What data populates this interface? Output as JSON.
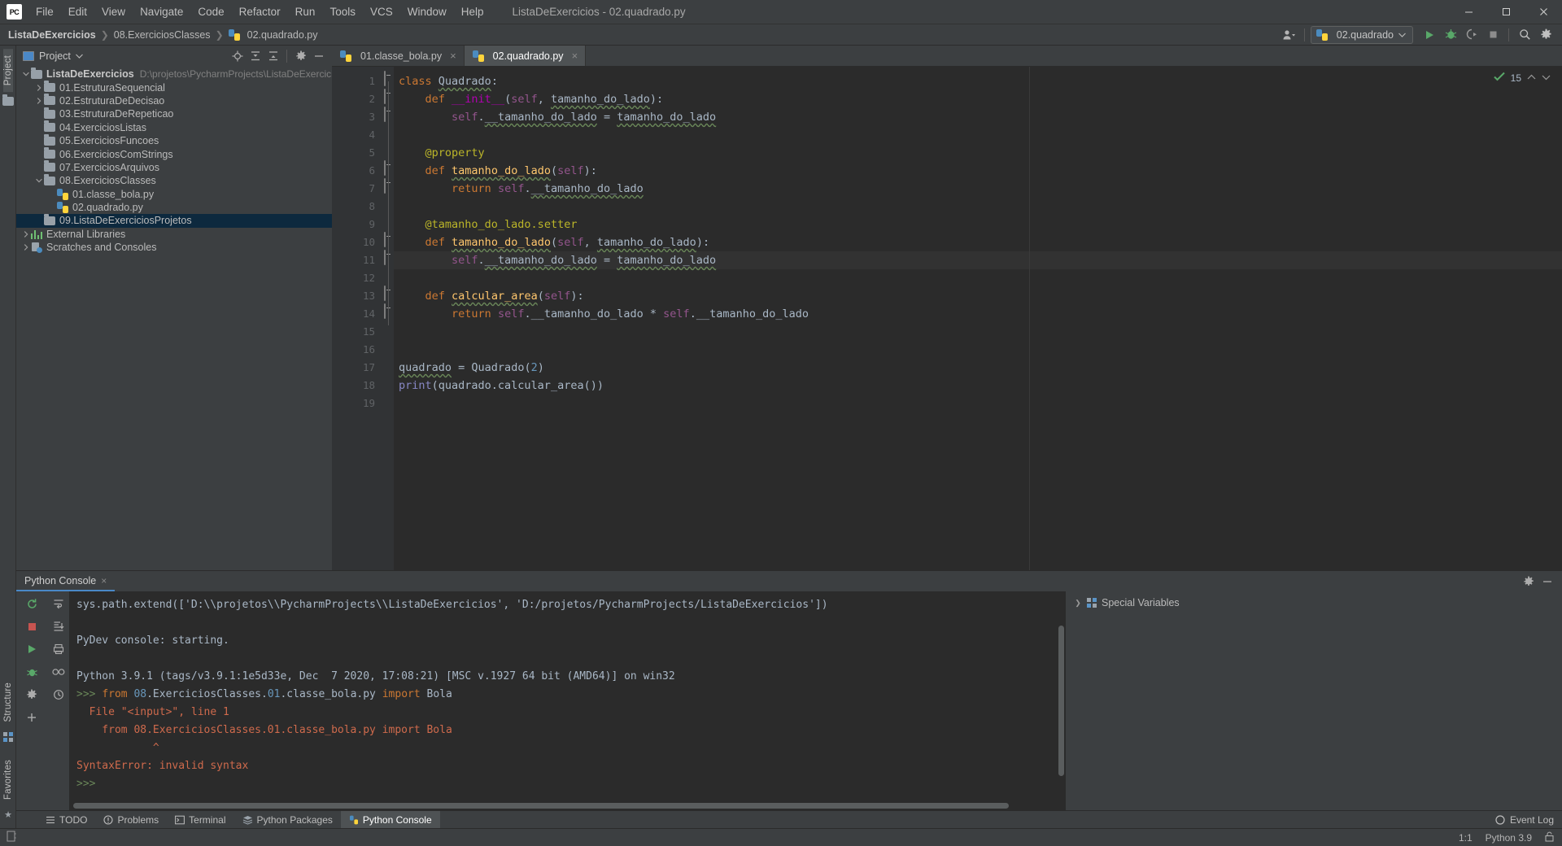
{
  "window": {
    "title": "ListaDeExercicios - 02.quadrado.py",
    "logo": "PC",
    "minimize": "—",
    "maximize": "❐",
    "close": "✕"
  },
  "menu": [
    {
      "label": "File"
    },
    {
      "label": "Edit"
    },
    {
      "label": "View"
    },
    {
      "label": "Navigate"
    },
    {
      "label": "Code"
    },
    {
      "label": "Refactor"
    },
    {
      "label": "Run"
    },
    {
      "label": "Tools"
    },
    {
      "label": "VCS"
    },
    {
      "label": "Window"
    },
    {
      "label": "Help"
    }
  ],
  "breadcrumb": [
    {
      "label": "ListaDeExercicios",
      "bold": true
    },
    {
      "label": "08.ExerciciosClasses",
      "bold": false
    },
    {
      "label": "02.quadrado.py",
      "bold": false,
      "icon": "python-file-icon"
    }
  ],
  "toolbar": {
    "run_config": "02.quadrado",
    "user_icon": "user-icon",
    "run_label": "Run",
    "debug_label": "Debug",
    "coverage_label": "Run with Coverage",
    "stop_label": "Stop",
    "search_label": "Search Everywhere",
    "settings_label": "Settings"
  },
  "project_panel": {
    "title": "Project",
    "actions": [
      "locate-icon",
      "expand-all-icon",
      "collapse-all-icon",
      "gear-icon",
      "hide-icon"
    ],
    "tree": [
      {
        "label": "ListaDeExercicios",
        "path": "D:\\projetos\\PycharmProjects\\ListaDeExercicios",
        "indent": 0,
        "arrow": "down",
        "icon": "folder",
        "bold": true,
        "selected": false
      },
      {
        "label": "01.EstruturaSequencial",
        "path": "",
        "indent": 1,
        "arrow": "right",
        "icon": "folder",
        "bold": false,
        "selected": false
      },
      {
        "label": "02.EstruturaDeDecisao",
        "path": "",
        "indent": 1,
        "arrow": "right",
        "icon": "folder",
        "bold": false,
        "selected": false
      },
      {
        "label": "03.EstruturaDeRepeticao",
        "path": "",
        "indent": 1,
        "arrow": "none",
        "icon": "folder",
        "bold": false,
        "selected": false
      },
      {
        "label": "04.ExerciciosListas",
        "path": "",
        "indent": 1,
        "arrow": "none",
        "icon": "folder",
        "bold": false,
        "selected": false
      },
      {
        "label": "05.ExerciciosFuncoes",
        "path": "",
        "indent": 1,
        "arrow": "none",
        "icon": "folder",
        "bold": false,
        "selected": false
      },
      {
        "label": "06.ExerciciosComStrings",
        "path": "",
        "indent": 1,
        "arrow": "none",
        "icon": "folder",
        "bold": false,
        "selected": false
      },
      {
        "label": "07.ExerciciosArquivos",
        "path": "",
        "indent": 1,
        "arrow": "none",
        "icon": "folder",
        "bold": false,
        "selected": false
      },
      {
        "label": "08.ExerciciosClasses",
        "path": "",
        "indent": 1,
        "arrow": "down",
        "icon": "folder",
        "bold": false,
        "selected": false
      },
      {
        "label": "01.classe_bola.py",
        "path": "",
        "indent": 2,
        "arrow": "none",
        "icon": "python",
        "bold": false,
        "selected": false
      },
      {
        "label": "02.quadrado.py",
        "path": "",
        "indent": 2,
        "arrow": "none",
        "icon": "python",
        "bold": false,
        "selected": false
      },
      {
        "label": "09.ListaDeExerciciosProjetos",
        "path": "",
        "indent": 1,
        "arrow": "none",
        "icon": "folder",
        "bold": false,
        "selected": true
      },
      {
        "label": "External Libraries",
        "path": "",
        "indent": 0,
        "arrow": "right",
        "icon": "libraries",
        "bold": false,
        "selected": false
      },
      {
        "label": "Scratches and Consoles",
        "path": "",
        "indent": 0,
        "arrow": "right",
        "icon": "scratches",
        "bold": false,
        "selected": false
      }
    ]
  },
  "editor": {
    "tabs": [
      {
        "label": "01.classe_bola.py",
        "active": false
      },
      {
        "label": "02.quadrado.py",
        "active": true
      }
    ],
    "inspection": {
      "count": "15",
      "status_icon": "inspection-ok-icon",
      "up": "⌃",
      "down": "⌄"
    },
    "caret_line": 11,
    "lines": [
      {
        "n": "1",
        "tokens": [
          {
            "t": "class",
            "c": "kw"
          },
          {
            "t": " ",
            "c": "plain"
          },
          {
            "t": "Quadrado",
            "c": "cls wave"
          },
          {
            "t": ":",
            "c": "plain"
          }
        ]
      },
      {
        "n": "2",
        "tokens": [
          {
            "t": "    ",
            "c": "plain"
          },
          {
            "t": "def",
            "c": "kw"
          },
          {
            "t": " ",
            "c": "plain"
          },
          {
            "t": "__init__",
            "c": "magic"
          },
          {
            "t": "(",
            "c": "plain"
          },
          {
            "t": "self",
            "c": "selfk"
          },
          {
            "t": ", ",
            "c": "plain"
          },
          {
            "t": "tamanho_do_lado",
            "c": "param wave"
          },
          {
            "t": "):",
            "c": "plain"
          }
        ]
      },
      {
        "n": "3",
        "tokens": [
          {
            "t": "        ",
            "c": "plain"
          },
          {
            "t": "self",
            "c": "selfk"
          },
          {
            "t": ".",
            "c": "plain"
          },
          {
            "t": "__tamanho_do_lado",
            "c": "plain wave"
          },
          {
            "t": " = ",
            "c": "plain"
          },
          {
            "t": "tamanho_do_lado",
            "c": "plain wave"
          }
        ]
      },
      {
        "n": "4",
        "tokens": []
      },
      {
        "n": "5",
        "tokens": [
          {
            "t": "    ",
            "c": "plain"
          },
          {
            "t": "@property",
            "c": "deco"
          }
        ]
      },
      {
        "n": "6",
        "tokens": [
          {
            "t": "    ",
            "c": "plain"
          },
          {
            "t": "def",
            "c": "kw"
          },
          {
            "t": " ",
            "c": "plain"
          },
          {
            "t": "tamanho_do_lado",
            "c": "dfn wave"
          },
          {
            "t": "(",
            "c": "plain"
          },
          {
            "t": "self",
            "c": "selfk"
          },
          {
            "t": "):",
            "c": "plain"
          }
        ]
      },
      {
        "n": "7",
        "tokens": [
          {
            "t": "        ",
            "c": "plain"
          },
          {
            "t": "return",
            "c": "kw"
          },
          {
            "t": " ",
            "c": "plain"
          },
          {
            "t": "self",
            "c": "selfk"
          },
          {
            "t": ".",
            "c": "plain"
          },
          {
            "t": "__tamanho_do_lado",
            "c": "plain wave"
          }
        ]
      },
      {
        "n": "8",
        "tokens": []
      },
      {
        "n": "9",
        "tokens": [
          {
            "t": "    ",
            "c": "plain"
          },
          {
            "t": "@tamanho_do_lado.setter",
            "c": "deco"
          }
        ]
      },
      {
        "n": "10",
        "tokens": [
          {
            "t": "    ",
            "c": "plain"
          },
          {
            "t": "def",
            "c": "kw"
          },
          {
            "t": " ",
            "c": "plain"
          },
          {
            "t": "tamanho_do_lado",
            "c": "dfn wave"
          },
          {
            "t": "(",
            "c": "plain"
          },
          {
            "t": "self",
            "c": "selfk"
          },
          {
            "t": ", ",
            "c": "plain"
          },
          {
            "t": "tamanho_do_lado",
            "c": "param wave"
          },
          {
            "t": "):",
            "c": "plain"
          }
        ]
      },
      {
        "n": "11",
        "tokens": [
          {
            "t": "        ",
            "c": "plain"
          },
          {
            "t": "self",
            "c": "selfk"
          },
          {
            "t": ".",
            "c": "plain"
          },
          {
            "t": "__tamanho_do_lado",
            "c": "plain wave"
          },
          {
            "t": " = ",
            "c": "plain"
          },
          {
            "t": "tamanho_do_lado",
            "c": "plain wave"
          }
        ]
      },
      {
        "n": "12",
        "tokens": []
      },
      {
        "n": "13",
        "tokens": [
          {
            "t": "    ",
            "c": "plain"
          },
          {
            "t": "def",
            "c": "kw"
          },
          {
            "t": " ",
            "c": "plain"
          },
          {
            "t": "calcular_area",
            "c": "dfn wave"
          },
          {
            "t": "(",
            "c": "plain"
          },
          {
            "t": "self",
            "c": "selfk"
          },
          {
            "t": "):",
            "c": "plain"
          }
        ]
      },
      {
        "n": "14",
        "tokens": [
          {
            "t": "        ",
            "c": "plain"
          },
          {
            "t": "return",
            "c": "kw"
          },
          {
            "t": " ",
            "c": "plain"
          },
          {
            "t": "self",
            "c": "selfk"
          },
          {
            "t": ".",
            "c": "plain"
          },
          {
            "t": "__tamanho_do_lado",
            "c": "plain"
          },
          {
            "t": " * ",
            "c": "plain"
          },
          {
            "t": "self",
            "c": "selfk"
          },
          {
            "t": ".",
            "c": "plain"
          },
          {
            "t": "__tamanho_do_lado",
            "c": "plain"
          }
        ]
      },
      {
        "n": "15",
        "tokens": []
      },
      {
        "n": "16",
        "tokens": []
      },
      {
        "n": "17",
        "tokens": [
          {
            "t": "quadrado",
            "c": "plain wave"
          },
          {
            "t": " = ",
            "c": "plain"
          },
          {
            "t": "Quadrado",
            "c": "plain"
          },
          {
            "t": "(",
            "c": "plain"
          },
          {
            "t": "2",
            "c": "num"
          },
          {
            "t": ")",
            "c": "plain"
          }
        ]
      },
      {
        "n": "18",
        "tokens": [
          {
            "t": "print",
            "c": "fn"
          },
          {
            "t": "(quadrado.calcular_area())",
            "c": "plain"
          }
        ]
      },
      {
        "n": "19",
        "tokens": []
      }
    ]
  },
  "console": {
    "tab_label": "Python Console",
    "close_icon": "×",
    "rail_actions": [
      "rerun-icon",
      "stop-icon",
      "execute-icon",
      "debug-icon",
      "settings-icon"
    ],
    "rail_actions2": [
      "soft-wrap-icon",
      "scroll-to-end-icon",
      "print-icon",
      "infinity-icon",
      "history-icon",
      "add-icon"
    ],
    "output": [
      {
        "segs": [
          {
            "t": "sys.path.extend(['D:\\\\projetos\\\\PycharmProjects\\\\ListaDeExercicios', 'D:/projetos/PycharmProjects/ListaDeExercicios'])",
            "c": "c-gray"
          }
        ]
      },
      {
        "segs": []
      },
      {
        "segs": [
          {
            "t": "PyDev console: starting.",
            "c": "c-gray"
          }
        ]
      },
      {
        "segs": []
      },
      {
        "segs": [
          {
            "t": "Python 3.9.1 (tags/v3.9.1:1e5d33e, Dec  7 2020, 17:08:21) [MSC v.1927 64 bit (AMD64)] on win32",
            "c": "c-gray"
          }
        ]
      },
      {
        "segs": [
          {
            "t": ">>> ",
            "c": "c-prompt"
          },
          {
            "t": "from",
            "c": "c-kw"
          },
          {
            "t": " ",
            "c": "c-gray"
          },
          {
            "t": "08",
            "c": "c-num"
          },
          {
            "t": ".ExerciciosClasses.",
            "c": "c-gray"
          },
          {
            "t": "01",
            "c": "c-num"
          },
          {
            "t": ".classe_bola.py ",
            "c": "c-gray"
          },
          {
            "t": "import",
            "c": "c-kw"
          },
          {
            "t": " Bola",
            "c": "c-gray"
          }
        ]
      },
      {
        "segs": [
          {
            "t": "  File \"<input>\", line 1",
            "c": "c-red"
          }
        ]
      },
      {
        "segs": [
          {
            "t": "    from 08.ExerciciosClasses.01.classe_bola.py import Bola",
            "c": "c-red"
          }
        ]
      },
      {
        "segs": [
          {
            "t": "            ^",
            "c": "c-red"
          }
        ]
      },
      {
        "segs": [
          {
            "t": "SyntaxError: invalid syntax",
            "c": "c-red"
          }
        ]
      },
      {
        "segs": [
          {
            "t": ">>> ",
            "c": "c-prompt"
          }
        ]
      }
    ],
    "special_variables": {
      "label": "Special Variables",
      "arrow": "❯",
      "icon": "variables-icon"
    },
    "header_actions": [
      "gear-icon",
      "hide-icon"
    ]
  },
  "bottom_strip": [
    {
      "label": "TODO",
      "icon": "todo-icon",
      "active": false
    },
    {
      "label": "Problems",
      "icon": "problems-icon",
      "active": false
    },
    {
      "label": "Terminal",
      "icon": "terminal-icon",
      "active": false
    },
    {
      "label": "Python Packages",
      "icon": "packages-icon",
      "active": false
    },
    {
      "label": "Python Console",
      "icon": "python-console-icon",
      "active": true
    }
  ],
  "bottom_right": {
    "label": "Event Log",
    "icon": "event-log-icon"
  },
  "statusbar": {
    "left_icon": "memory-indicator-icon",
    "position": "1:1",
    "interpreter": "Python 3.9",
    "lock_icon": "lock-icon"
  },
  "left_rail": {
    "project_label": "Project",
    "structure_label": "Structure",
    "favorites_label": "Favorites"
  }
}
